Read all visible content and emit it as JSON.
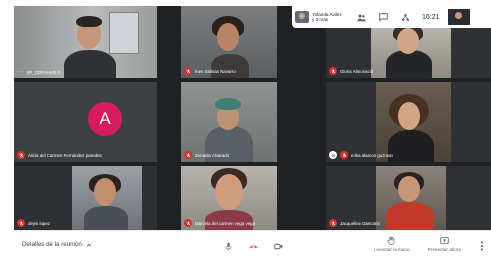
{
  "overlay": {
    "presenter_line1": "Yolanda Avilez",
    "presenter_line2": "y 3 más",
    "time": "16:21",
    "icons": [
      "people-icon",
      "chat-icon",
      "activities-icon"
    ]
  },
  "tiles": [
    {
      "name": "SP_CDRAHUE 2",
      "muted": false,
      "variant": "man"
    },
    {
      "name": "Ines Salinas Navarro",
      "muted": true,
      "variant": "woman-dark"
    },
    {
      "name": "Gloria Almonacid",
      "muted": true,
      "variant": "woman-light"
    },
    {
      "name": "Alicia del Carmen Fernández paredes",
      "muted": true,
      "variant": "avatar",
      "avatar_letter": "A",
      "avatar_color": "#d81b60"
    },
    {
      "name": "Zenaida Alvarado",
      "muted": true,
      "variant": "woman-hat"
    },
    {
      "name": "erika alarcon guzman",
      "muted": true,
      "variant": "woman-curly",
      "pin": true
    },
    {
      "name": "deysi lopez",
      "muted": true,
      "variant": "woman-room"
    },
    {
      "name": "Marcela del carmen vega vega",
      "muted": true,
      "variant": "woman-close"
    },
    {
      "name": "Jacqueline Dancarte",
      "muted": true,
      "variant": "woman-red"
    }
  ],
  "toolbar": {
    "details_label": "Detalles de la reunión",
    "raise_hand_label": "Levantar la mano",
    "present_label": "Presentar ahora"
  },
  "colors": {
    "mute_red": "#d93025",
    "end_call_red": "#ea4335",
    "stage_bg": "#202124"
  }
}
